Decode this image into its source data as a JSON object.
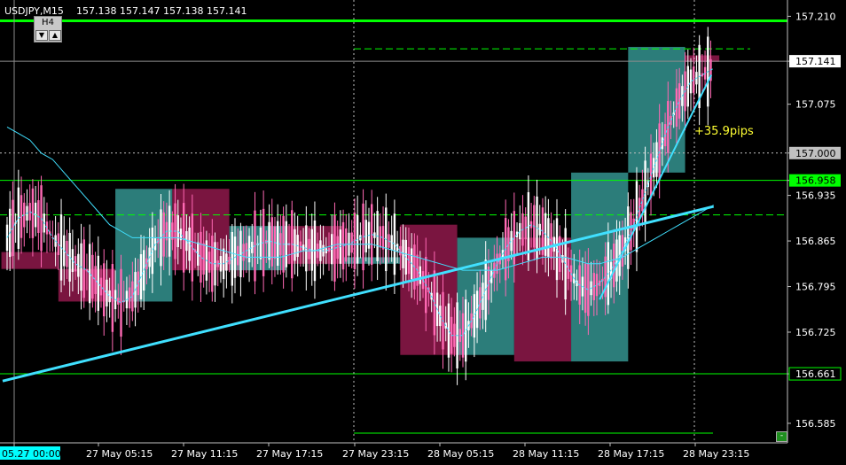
{
  "header": {
    "symbol": "USDJPY,M15",
    "ohlc": "157.138 157.147 157.138 157.141"
  },
  "timeframe_box": {
    "label": "H4",
    "down_icon": "triangle-down-icon",
    "up_icon": "triangle-up-icon"
  },
  "annotation": {
    "pips_text": "+35.9pips"
  },
  "minimize_button": {
    "label": "-"
  },
  "colors": {
    "bull_candle": "#ffffff",
    "bear_candle": "#ff69b4",
    "bull_box": "#2c7d7a",
    "bear_box": "#7a1540",
    "level_line": "#00ff00",
    "ma_line": "#40e0ff",
    "grid": "#c0c0c0"
  },
  "chart_data": {
    "type": "candlestick",
    "symbol": "USDJPY",
    "timeframe": "M15",
    "ylim": [
      156.555,
      157.235
    ],
    "y_ticks": [
      "157.210",
      "157.141",
      "157.075",
      "157.000",
      "156.958",
      "156.935",
      "156.865",
      "156.795",
      "156.725",
      "156.661",
      "156.585"
    ],
    "x_ticks": [
      "05.27 00:00",
      "27 May 05:15",
      "27 May 11:15",
      "27 May 17:15",
      "27 May 23:15",
      "28 May 05:15",
      "28 May 11:15",
      "28 May 17:15",
      "28 May 23:15"
    ],
    "price_labels": [
      {
        "text": "157.141",
        "value": 157.141,
        "style": "current"
      },
      {
        "text": "157.000",
        "value": 157.0,
        "style": "grey"
      },
      {
        "text": "156.958",
        "value": 156.958,
        "style": "green"
      },
      {
        "text": "156.661",
        "value": 156.661,
        "style": "green-outline"
      }
    ],
    "levels": [
      {
        "value": 157.203,
        "style": "solid-thick",
        "range": "full"
      },
      {
        "value": 157.16,
        "style": "dashed",
        "range": "27 May 23:15 onward"
      },
      {
        "value": 156.958,
        "style": "solid",
        "range": "full"
      },
      {
        "value": 156.905,
        "style": "dashed",
        "range": "full"
      },
      {
        "value": 156.661,
        "style": "solid",
        "range": "full"
      },
      {
        "value": 156.57,
        "style": "solid",
        "range": "27 May 23:15 onward"
      }
    ],
    "h4_boxes": [
      {
        "start": 0,
        "end": 5,
        "open": 156.848,
        "close": 156.822,
        "high": 156.93,
        "low": 156.68,
        "dir": "bear"
      },
      {
        "start": 5,
        "end": 10,
        "open": 156.822,
        "close": 156.772,
        "high": 156.86,
        "low": 156.66,
        "dir": "bear"
      },
      {
        "start": 10,
        "end": 15,
        "open": 156.772,
        "close": 156.945,
        "high": 156.952,
        "low": 156.76,
        "dir": "bull"
      },
      {
        "start": 15,
        "end": 20,
        "open": 156.945,
        "close": 156.82,
        "high": 156.955,
        "low": 156.81,
        "dir": "bear"
      },
      {
        "start": 20,
        "end": 25,
        "open": 156.82,
        "close": 156.888,
        "high": 156.9,
        "low": 156.78,
        "dir": "bull"
      },
      {
        "start": 25,
        "end": 30,
        "open": 156.888,
        "close": 156.83,
        "high": 156.9,
        "low": 156.82,
        "dir": "bear"
      },
      {
        "start": 30,
        "end": 35,
        "open": 156.83,
        "close": 156.84,
        "high": 156.93,
        "low": 156.79,
        "dir": "bull"
      },
      {
        "start": 35,
        "end": 40,
        "open": 156.89,
        "close": 156.69,
        "high": 156.9,
        "low": 156.64,
        "dir": "bear"
      },
      {
        "start": 40,
        "end": 45,
        "open": 156.69,
        "close": 156.87,
        "high": 156.88,
        "low": 156.65,
        "dir": "bull"
      },
      {
        "start": 45,
        "end": 50,
        "open": 156.87,
        "close": 156.68,
        "high": 156.99,
        "low": 156.63,
        "dir": "bear"
      },
      {
        "start": 50,
        "end": 55,
        "open": 156.68,
        "close": 156.97,
        "high": 156.98,
        "low": 156.585,
        "dir": "bull"
      },
      {
        "start": 55,
        "end": 60,
        "open": 156.97,
        "close": 157.163,
        "high": 157.205,
        "low": 156.9,
        "dir": "bull"
      },
      {
        "start": 60,
        "end": 63,
        "open": 157.15,
        "close": 157.14,
        "high": 157.17,
        "low": 157.1,
        "dir": "bear"
      }
    ],
    "ma_fast_values": [
      156.87,
      156.9,
      156.91,
      156.9,
      156.87,
      156.85,
      156.83,
      156.82,
      156.8,
      156.78,
      156.77,
      156.78,
      156.82,
      156.86,
      156.88,
      156.88,
      156.86,
      156.84,
      156.83,
      156.83,
      156.84,
      156.85,
      156.86,
      156.865,
      156.86,
      156.86,
      156.855,
      156.85,
      156.85,
      156.855,
      156.86,
      156.87,
      156.875,
      156.87,
      156.86,
      156.84,
      156.82,
      156.79,
      156.75,
      156.72,
      156.72,
      156.75,
      156.79,
      156.83,
      156.86,
      156.88,
      156.89,
      156.88,
      156.86,
      156.83,
      156.8,
      156.79,
      156.8,
      156.82,
      156.85,
      156.89,
      156.94,
      156.99,
      157.04,
      157.08,
      157.11,
      157.12,
      157.13
    ],
    "ma_slow_values": [
      157.04,
      157.03,
      157.02,
      157.0,
      156.99,
      156.97,
      156.95,
      156.93,
      156.91,
      156.89,
      156.88,
      156.87,
      156.87,
      156.87,
      156.87,
      156.87,
      156.865,
      156.86,
      156.855,
      156.85,
      156.845,
      156.84,
      156.84,
      156.84,
      156.84,
      156.845,
      156.85,
      156.85,
      156.855,
      156.86,
      156.86,
      156.86,
      156.86,
      156.855,
      156.85,
      156.845,
      156.84,
      156.835,
      156.83,
      156.825,
      156.82,
      156.82,
      156.82,
      156.82,
      156.825,
      156.83,
      156.835,
      156.84,
      156.84,
      156.84,
      156.835,
      156.83,
      156.83,
      156.835,
      156.84,
      156.85,
      156.86,
      156.87,
      156.88,
      156.89,
      156.9,
      156.91,
      156.92
    ],
    "trend_line": {
      "from_index": 0,
      "from_value": 156.65,
      "to_index": 62,
      "to_value": 156.918
    },
    "move_line": {
      "from_index": 52,
      "from_value": 156.775,
      "to_index": 61.8,
      "to_value": 157.12,
      "label": "+35.9pips"
    }
  }
}
